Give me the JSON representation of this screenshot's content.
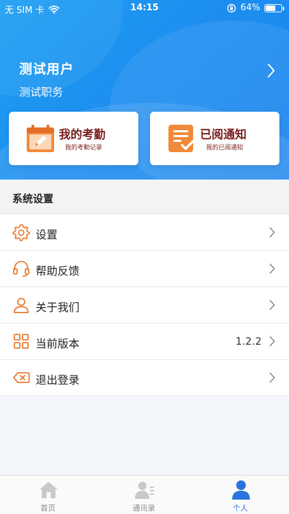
{
  "status_bar": {
    "carrier": "无 SIM 卡",
    "time": "14:15",
    "battery": "64%",
    "battery_level": 0.64
  },
  "profile": {
    "name": "测试用户",
    "role": "测试职务"
  },
  "cards": [
    {
      "title": "我的考勤",
      "subtitle": "我的考勤记录",
      "icon": "calendar-pencil-icon"
    },
    {
      "title": "已阅通知",
      "subtitle": "我的已阅通知",
      "icon": "document-check-icon"
    }
  ],
  "section": {
    "title": "系统设置"
  },
  "menu": [
    {
      "label": "设置",
      "icon": "gear-icon",
      "value": ""
    },
    {
      "label": "帮助反馈",
      "icon": "headset-icon",
      "value": ""
    },
    {
      "label": "关于我们",
      "icon": "person-icon",
      "value": ""
    },
    {
      "label": "当前版本",
      "icon": "grid-icon",
      "value": "1.2.2"
    },
    {
      "label": "退出登录",
      "icon": "delete-key-icon",
      "value": ""
    }
  ],
  "tabs": [
    {
      "label": "首页",
      "icon": "home-icon",
      "active": false
    },
    {
      "label": "通讯录",
      "icon": "contacts-icon",
      "active": false
    },
    {
      "label": "个人",
      "icon": "user-icon",
      "active": true
    }
  ],
  "colors": {
    "header_blue": "#1d8ff0",
    "accent_orange": "#e97a2e",
    "card_text": "#7a1f1f",
    "tab_active": "#2a75dd"
  }
}
